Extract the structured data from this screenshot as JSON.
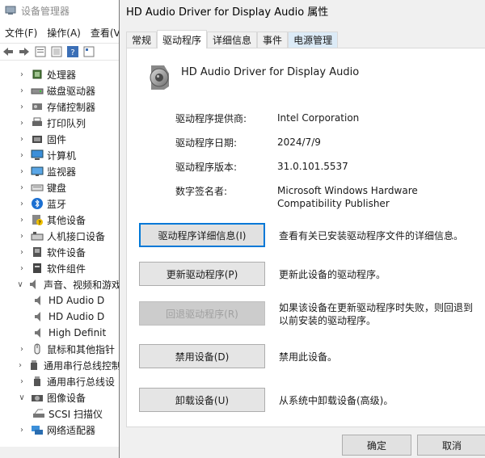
{
  "device_manager": {
    "title": "设备管理器",
    "menu": [
      "文件(F)",
      "操作(A)",
      "查看(V"
    ],
    "tree": [
      {
        "label": "处理器",
        "icon": "cpu-icon",
        "expanded": false
      },
      {
        "label": "磁盘驱动器",
        "icon": "disk-drive-icon",
        "expanded": false
      },
      {
        "label": "存储控制器",
        "icon": "storage-controller-icon",
        "expanded": false
      },
      {
        "label": "打印队列",
        "icon": "printer-icon",
        "expanded": false
      },
      {
        "label": "固件",
        "icon": "firmware-icon",
        "expanded": false
      },
      {
        "label": "计算机",
        "icon": "computer-icon",
        "expanded": false
      },
      {
        "label": "监视器",
        "icon": "monitor-icon",
        "expanded": false
      },
      {
        "label": "键盘",
        "icon": "keyboard-icon",
        "expanded": false
      },
      {
        "label": "蓝牙",
        "icon": "bluetooth-icon",
        "expanded": false
      },
      {
        "label": "其他设备",
        "icon": "other-devices-icon",
        "expanded": false
      },
      {
        "label": "人机接口设备",
        "icon": "hid-icon",
        "expanded": false
      },
      {
        "label": "软件设备",
        "icon": "software-device-icon",
        "expanded": false
      },
      {
        "label": "软件组件",
        "icon": "software-component-icon",
        "expanded": false
      },
      {
        "label": "声音、视频和游戏",
        "icon": "speaker-icon",
        "expanded": true
      },
      {
        "label": "HD Audio D",
        "icon": "speaker-icon",
        "child": true
      },
      {
        "label": "HD Audio D",
        "icon": "speaker-icon",
        "child": true
      },
      {
        "label": "High Definit",
        "icon": "speaker-icon",
        "child": true
      },
      {
        "label": "鼠标和其他指针",
        "icon": "mouse-icon",
        "expanded": false
      },
      {
        "label": "通用串行总线控制",
        "icon": "usb-icon",
        "expanded": false
      },
      {
        "label": "通用串行总线设",
        "icon": "usb-icon",
        "expanded": false
      },
      {
        "label": "图像设备",
        "icon": "camera-icon",
        "expanded": true
      },
      {
        "label": "SCSI 扫描仪",
        "icon": "scanner-icon",
        "child": true
      },
      {
        "label": "网络适配器",
        "icon": "network-adapter-icon",
        "expanded": false
      }
    ]
  },
  "dialog": {
    "title": "HD Audio Driver for Display Audio 属性",
    "tabs": [
      "常规",
      "驱动程序",
      "详细信息",
      "事件",
      "电源管理"
    ],
    "active_tab": "驱动程序",
    "device_name": "HD Audio Driver for Display Audio",
    "info": {
      "provider_label": "驱动程序提供商:",
      "provider_value": "Intel Corporation",
      "date_label": "驱动程序日期:",
      "date_value": "2024/7/9",
      "version_label": "驱动程序版本:",
      "version_value": "31.0.101.5537",
      "signer_label": "数字签名者:",
      "signer_value": "Microsoft Windows Hardware Compatibility Publisher"
    },
    "actions": [
      {
        "label": "驱动程序详细信息(I)",
        "desc": "查看有关已安装驱动程序文件的详细信息。",
        "state": "focused"
      },
      {
        "label": "更新驱动程序(P)",
        "desc": "更新此设备的驱动程序。",
        "state": "normal"
      },
      {
        "label": "回退驱动程序(R)",
        "desc": "如果该设备在更新驱动程序时失败，则回退到以前安装的驱动程序。",
        "state": "disabled"
      },
      {
        "label": "禁用设备(D)",
        "desc": "禁用此设备。",
        "state": "normal"
      },
      {
        "label": "卸载设备(U)",
        "desc": "从系统中卸载设备(高级)。",
        "state": "normal"
      }
    ],
    "ok_label": "确定",
    "cancel_label": "取消"
  },
  "colors": {
    "focus_border": "#0078d7",
    "dialog_bg": "#f0f0f0",
    "power_tab_bg": "#dcebf7"
  }
}
